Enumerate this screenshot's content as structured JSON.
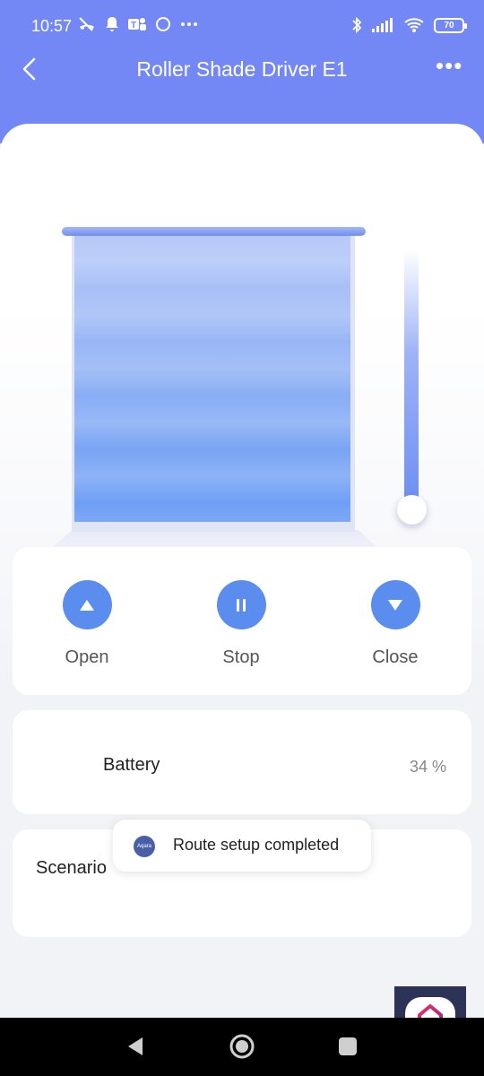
{
  "status_bar": {
    "time": "10:57",
    "battery_level": "70",
    "left_icons": [
      "missed-call-icon",
      "notification-bell-icon",
      "teams-icon",
      "circle-icon",
      "more-dots-icon"
    ],
    "right_icons": [
      "bluetooth-icon",
      "signal-icon",
      "wifi-icon",
      "battery-icon"
    ]
  },
  "header": {
    "title": "Roller Shade Driver E1",
    "back_icon": "chevron-left-icon",
    "more_label": "•••"
  },
  "shade": {
    "position_fraction": 0.0
  },
  "controls": {
    "open_label": "Open",
    "stop_label": "Stop",
    "close_label": "Close"
  },
  "battery": {
    "label": "Battery",
    "value": "34 %"
  },
  "scenario": {
    "label": "Scenario"
  },
  "toast": {
    "logo_text": "Aqara",
    "message": "Route setup completed"
  },
  "colors": {
    "header": "#7388f4",
    "accent": "#5b8def",
    "background": "#f2f3f7"
  }
}
